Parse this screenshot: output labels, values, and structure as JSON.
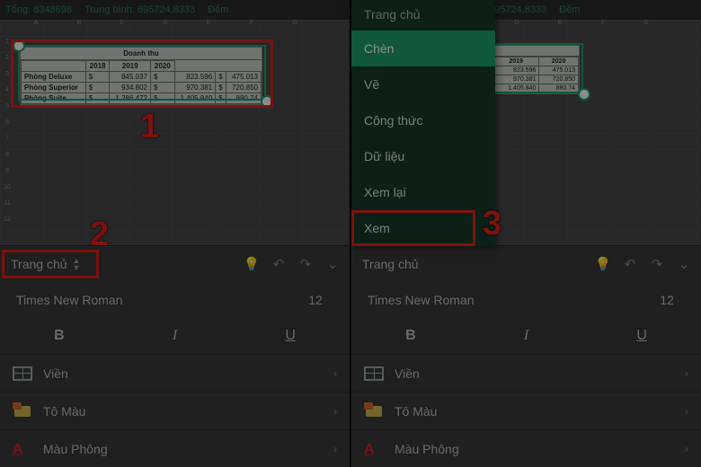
{
  "status": {
    "sum_label": "Tổng:",
    "sum": "8348698",
    "avg_label": "Trung bình:",
    "avg": "695724,8333",
    "count_label": "Đếm"
  },
  "table": {
    "title": "Doanh thu",
    "years": [
      "2018",
      "2019",
      "2020"
    ],
    "rows": [
      {
        "name": "Phòng Deluxe",
        "v": [
          "845.037",
          "823.596",
          "475.013"
        ]
      },
      {
        "name": "Phòng Superior",
        "v": [
          "934.802",
          "970.381",
          "720.850"
        ]
      },
      {
        "name": "Phòng Suite",
        "v": [
          "1.286.472",
          "1.405.840",
          "880.74"
        ]
      }
    ],
    "currency": "$"
  },
  "toolbar": {
    "tab": "Trang chủ",
    "font": "Times New Roman",
    "size": "12",
    "bold": "B",
    "italic": "I",
    "under": "U",
    "borders": "Viền",
    "fill": "Tô Màu",
    "fontcolor": "Màu Phông"
  },
  "menu": {
    "header": "Trang chủ",
    "items": [
      "Chèn",
      "Vẽ",
      "Công thức",
      "Dữ liệu",
      "Xem lại",
      "Xem"
    ],
    "activeIndex": 0
  },
  "callouts": {
    "c1": "1",
    "c2": "2",
    "c3": "3"
  }
}
